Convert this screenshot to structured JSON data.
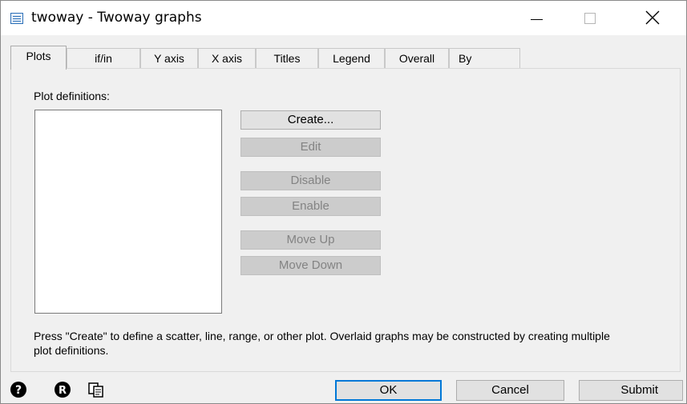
{
  "window": {
    "title": "twoway - Twoway graphs"
  },
  "tabs": [
    {
      "label": "Plots",
      "active": true
    },
    {
      "label": "if/in"
    },
    {
      "label": "Y axis"
    },
    {
      "label": "X axis"
    },
    {
      "label": "Titles"
    },
    {
      "label": "Legend"
    },
    {
      "label": "Overall"
    },
    {
      "label": "By"
    }
  ],
  "plots": {
    "definitions_label": "Plot definitions:",
    "buttons": {
      "create": "Create...",
      "edit": "Edit",
      "disable": "Disable",
      "enable": "Enable",
      "move_up": "Move Up",
      "move_down": "Move Down"
    },
    "hint": "Press \"Create\" to define a scatter, line, range, or other plot. Overlaid graphs may be constructed by creating multiple plot definitions."
  },
  "footer": {
    "ok": "OK",
    "cancel": "Cancel",
    "submit": "Submit",
    "icons": [
      "help-icon",
      "reset-icon",
      "copy-command-icon"
    ]
  }
}
